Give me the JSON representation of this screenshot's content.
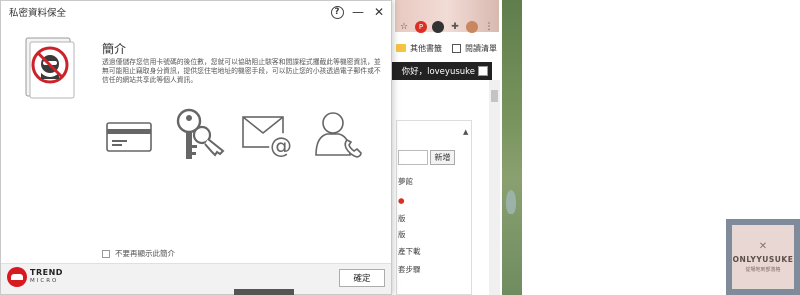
{
  "dialog": {
    "title": "私密資料保全",
    "help_label": "?",
    "minimize_label": "—",
    "close_label": "✕",
    "heading": "簡介",
    "description": "透過僅儲存您信用卡號碼的後位數，您就可以協助阻止駭客和間諜程式攫截此等機密資訊，並無可能阻止竊取身分資訊，提供您住宅地址的機密手段，可以防止您的小孩透過電子郵件或不信任的網站共享此等個人資訊。",
    "checkbox_label": "不要再顯示此簡介",
    "ok_label": "確定",
    "brand_trend": "TREND",
    "brand_micro": "MICRO",
    "features": [
      "credit-card-icon",
      "keys-icon",
      "email-icon",
      "phone-contact-icon"
    ]
  },
  "background_browser": {
    "bookmark_folder": "其他書籤",
    "reading_list": "閱讀清單",
    "greeting": "你好，loveyusuke",
    "add_button": "新增",
    "lines": [
      "夢館",
      "版",
      "版",
      "產下載",
      "套步驟"
    ]
  },
  "watermark": {
    "title": "ONLYYUSUKE",
    "subtitle": "從場地到部落格"
  },
  "colors": {
    "brand_red": "#d71921",
    "footer_bg": "#f2f2f2",
    "icon_gray": "#666666"
  }
}
